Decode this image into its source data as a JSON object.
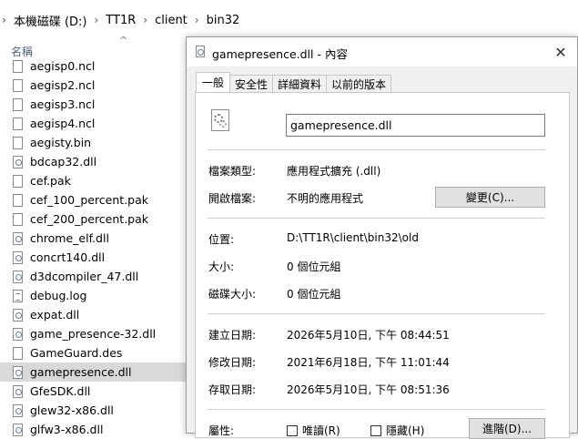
{
  "breadcrumb": {
    "items": [
      "本機磁碟 (D:)",
      "TT1R",
      "client",
      "bin32"
    ]
  },
  "file_list": {
    "column_name": "名稱",
    "files": [
      {
        "name": "aegisp0.ncl",
        "icon": "file-icon"
      },
      {
        "name": "aegisp2.ncl",
        "icon": "file-icon"
      },
      {
        "name": "aegisp3.ncl",
        "icon": "file-icon"
      },
      {
        "name": "aegisp4.ncl",
        "icon": "file-icon"
      },
      {
        "name": "aegisty.bin",
        "icon": "file-icon"
      },
      {
        "name": "bdcap32.dll",
        "icon": "dll-file-icon"
      },
      {
        "name": "cef.pak",
        "icon": "file-icon"
      },
      {
        "name": "cef_100_percent.pak",
        "icon": "file-icon"
      },
      {
        "name": "cef_200_percent.pak",
        "icon": "file-icon"
      },
      {
        "name": "chrome_elf.dll",
        "icon": "dll-file-icon"
      },
      {
        "name": "concrt140.dll",
        "icon": "dll-file-icon"
      },
      {
        "name": "d3dcompiler_47.dll",
        "icon": "dll-file-icon"
      },
      {
        "name": "debug.log",
        "icon": "log-file-icon"
      },
      {
        "name": "expat.dll",
        "icon": "dll-file-icon"
      },
      {
        "name": "game_presence-32.dll",
        "icon": "dll-file-icon"
      },
      {
        "name": "GameGuard.des",
        "icon": "file-icon"
      },
      {
        "name": "gamepresence.dll",
        "icon": "dll-file-icon",
        "selected": true
      },
      {
        "name": "GfeSDK.dll",
        "icon": "dll-file-icon"
      },
      {
        "name": "glew32-x86.dll",
        "icon": "dll-file-icon"
      },
      {
        "name": "glfw3-x86.dll",
        "icon": "dll-file-icon"
      }
    ]
  },
  "dialog": {
    "title": "gamepresence.dll - 內容",
    "tabs": [
      "一般",
      "安全性",
      "詳細資料",
      "以前的版本"
    ],
    "file_name": "gamepresence.dll",
    "type_label": "檔案類型:",
    "type_value": "應用程式擴充 (.dll)",
    "opens_label": "開啟檔案:",
    "opens_value": "不明的應用程式",
    "change_button": "變更(C)...",
    "location_label": "位置:",
    "location_value": "D:\\TT1R\\client\\bin32\\old",
    "size_label": "大小:",
    "size_value": "0 個位元組",
    "size_on_disk_label": "磁碟大小:",
    "size_on_disk_value": "0 個位元組",
    "created_label": "建立日期:",
    "created_value": "2026年5月10日, 下午 08:44:51",
    "modified_label": "修改日期:",
    "modified_value": "2021年6月18日, 下午 11:01:44",
    "accessed_label": "存取日期:",
    "accessed_value": "2026年5月10日, 下午 08:51:36",
    "attributes_label": "屬性:",
    "readonly_label": "唯讀(R)",
    "hidden_label": "隱藏(H)",
    "advanced_button": "進階(D)..."
  }
}
